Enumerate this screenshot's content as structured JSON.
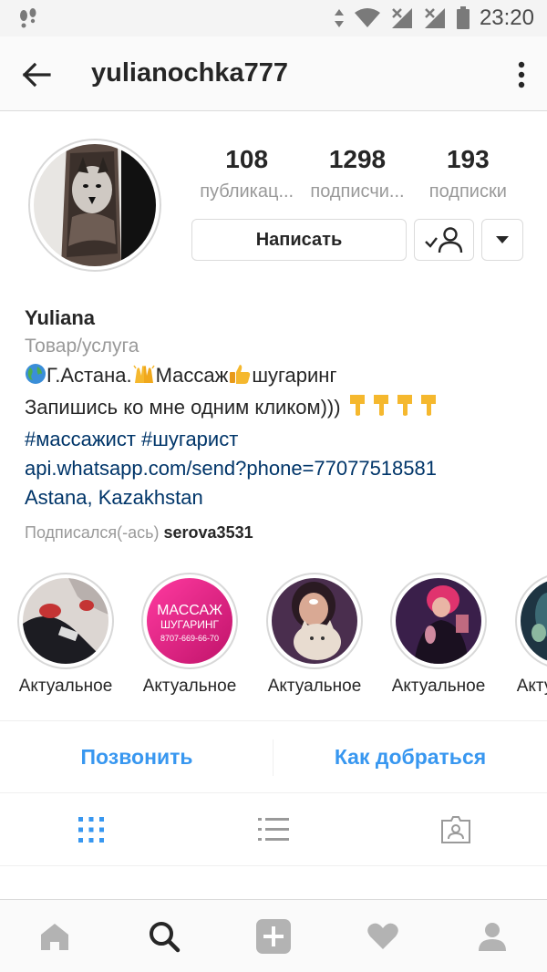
{
  "status_bar": {
    "time": "23:20",
    "icons": [
      "footprints-icon",
      "data-arrows-icon",
      "wifi-icon",
      "signal-no-sim-icon",
      "signal-icon",
      "battery-icon"
    ]
  },
  "header": {
    "username": "yulianochka777",
    "back_icon": "arrow-left-icon",
    "more_icon": "more-vertical-icon"
  },
  "profile": {
    "stats": [
      {
        "value": "108",
        "label": "публикац..."
      },
      {
        "value": "1298",
        "label": "подписчи..."
      },
      {
        "value": "193",
        "label": "подписки"
      }
    ],
    "message_label": "Написать",
    "follow_icon": "following-check-user-icon",
    "dropdown_icon": "caret-down-icon"
  },
  "bio": {
    "name": "Yuliana",
    "category": "Товар/услуга",
    "line1": {
      "part1": "Г.Астана.",
      "part2": "Массаж",
      "part3": "шугаринг"
    },
    "line2": "Запишись ко мне одним кликом)))",
    "hashtags": "#массажист #шугарист",
    "link": "api.whatsapp.com/send?phone=77077518581",
    "location": "Astana, Kazakhstan",
    "followed_by_prefix": "Подписался(-ась)",
    "followed_by_user": "serova3531"
  },
  "highlights": [
    {
      "label": "Актуальное"
    },
    {
      "label": "Актуальное",
      "promo_title": "МАССАЖ",
      "promo_subtitle": "ШУГАРИНГ",
      "promo_phone": "8707-669-66-70"
    },
    {
      "label": "Актуальное"
    },
    {
      "label": "Актуальное"
    },
    {
      "label": "Актуальное"
    }
  ],
  "actions": {
    "call": "Позвонить",
    "directions": "Как добраться"
  },
  "tabs": [
    "grid-icon",
    "list-icon",
    "tagged-icon"
  ],
  "bottom_nav": [
    "home-icon",
    "search-icon",
    "add-icon",
    "heart-icon",
    "profile-icon"
  ],
  "colors": {
    "accent_blue": "#3897f0",
    "link_navy": "#003569",
    "muted_gray": "#999999",
    "text_dark": "#262626"
  }
}
